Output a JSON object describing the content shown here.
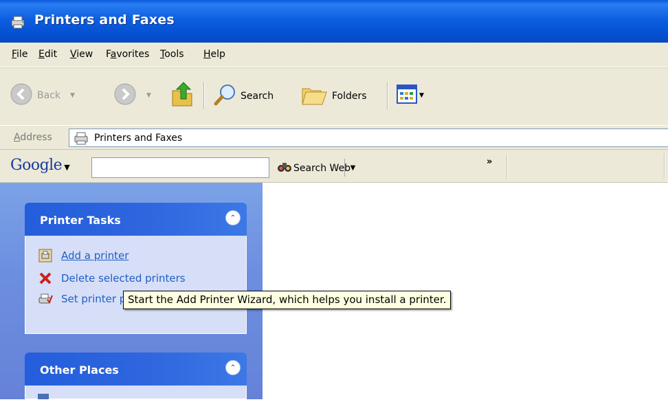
{
  "window": {
    "title": "Printers and Faxes"
  },
  "menu": [
    {
      "label": "File",
      "accel": "F"
    },
    {
      "label": "Edit",
      "accel": "E"
    },
    {
      "label": "View",
      "accel": "V"
    },
    {
      "label": "Favorites",
      "accel": "a"
    },
    {
      "label": "Tools",
      "accel": "T"
    },
    {
      "label": "Help",
      "accel": "H"
    }
  ],
  "toolbar": {
    "back_label": "Back",
    "search_label": "Search",
    "folders_label": "Folders"
  },
  "address": {
    "label": "Address",
    "value": "Printers and Faxes"
  },
  "google": {
    "logo": "Google",
    "search_value": "",
    "search_web_label": "Search Web",
    "more_symbol": "»"
  },
  "sidebar": {
    "printer_tasks": {
      "title": "Printer Tasks",
      "items": [
        {
          "label": "Add a printer"
        },
        {
          "label": "Delete selected printers"
        },
        {
          "label": "Set printer properties"
        }
      ]
    },
    "other_places": {
      "title": "Other Places"
    }
  },
  "tooltip": {
    "text": "Start the Add Printer Wizard, which helps you install a printer."
  },
  "colors": {
    "titlebar": "#0d5fe0",
    "task_link": "#215dc6",
    "sidebar_bg": "#6d8fe0",
    "panel_header": "#245edc",
    "tooltip_bg": "#ffffe1"
  }
}
